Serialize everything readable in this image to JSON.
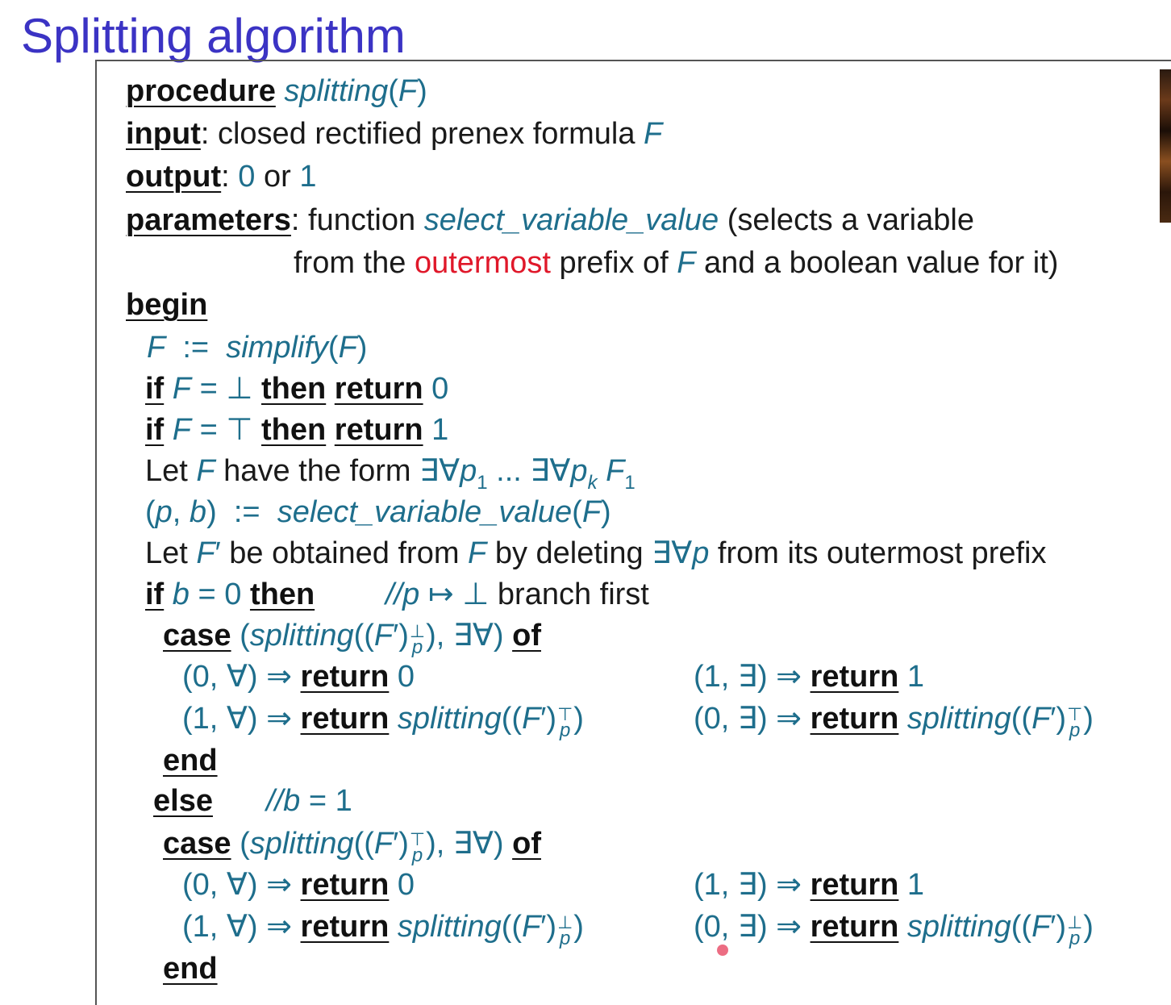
{
  "title": "Splitting algorithm",
  "sym": {
    "lp": "(",
    "rp": ")",
    "assign": ":=",
    "eq": "=",
    "bot": "⊥",
    "top": "⊤",
    "exall": "∃∀",
    "dots": "...",
    "comma": ",",
    "arrow": "⇒",
    "mapsto": "↦",
    "prime": "′",
    "comment": "//",
    "forall": "∀",
    "exists": "∃"
  },
  "vars": {
    "F": "F",
    "F1": "F",
    "one_sub": "1",
    "p": "p",
    "k": "k",
    "b": "b",
    "zero": "0",
    "one": "1"
  },
  "keywords": {
    "procedure": "procedure",
    "input": "input",
    "output": "output",
    "parameters": "parameters",
    "begin": "begin",
    "if": "if",
    "then": "then",
    "return": "return",
    "case": "case",
    "of": "of",
    "end": "end",
    "else": "else"
  },
  "funcs": {
    "splitting": "splitting",
    "simplify": "simplify",
    "select": "select_variable_value"
  },
  "text": {
    "colon": ":",
    "input_desc": "closed rectified prenex formula",
    "or": "or",
    "function_word": "function",
    "selects": "(selects a variable",
    "from_the": "from the",
    "outermost": "outermost",
    "prefix_of": "prefix of",
    "and_bool": "and a boolean value for it)",
    "let": "Let",
    "have_form": "have the form",
    "be_obtained": "be obtained from",
    "by_deleting": "by deleting",
    "from_prefix": "from its outermost prefix",
    "branch_first": "branch first"
  }
}
